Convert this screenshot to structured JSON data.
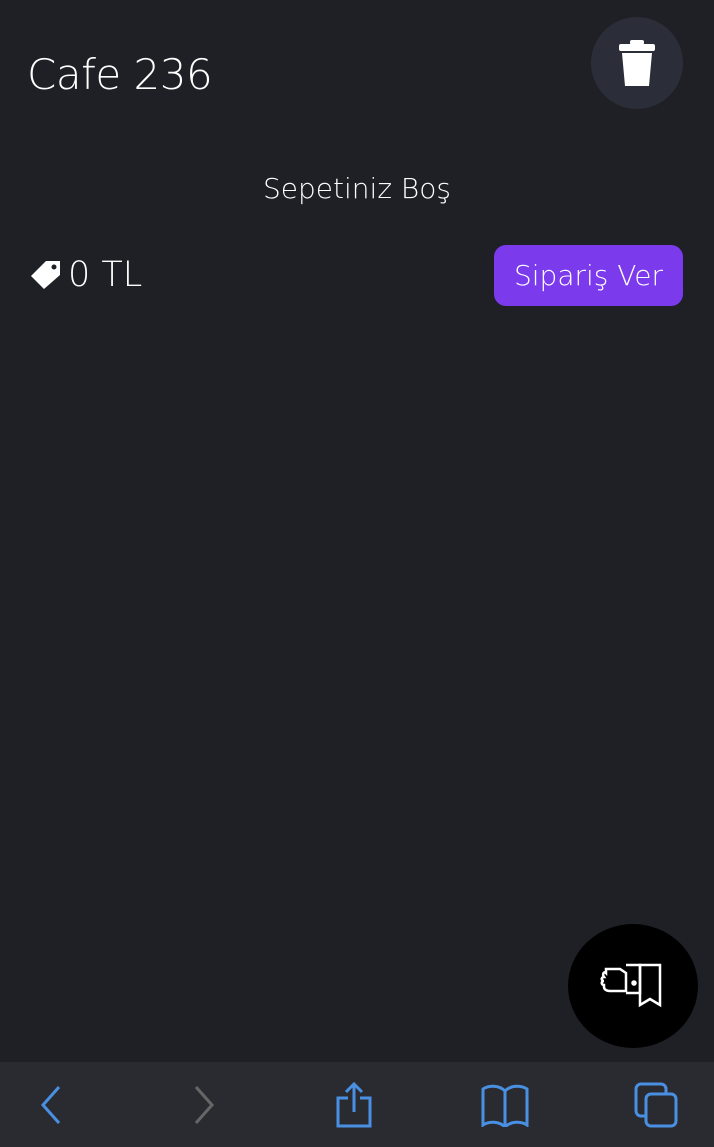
{
  "header": {
    "title": "Cafe 236",
    "clear_icon": "trash-icon"
  },
  "cart": {
    "empty_message": "Sepetiniz Boş",
    "total": "0 TL",
    "price_icon": "tag-icon",
    "order_button": "Sipariş Ver"
  },
  "fab": {
    "icon": "call-waiter-icon"
  },
  "browser_toolbar": {
    "items": [
      "back-icon",
      "forward-icon",
      "share-icon",
      "bookmarks-icon",
      "tabs-icon"
    ]
  },
  "colors": {
    "background": "#1f2026",
    "accent": "#7c3aed",
    "toolbar_icon": "#4a90e2"
  }
}
